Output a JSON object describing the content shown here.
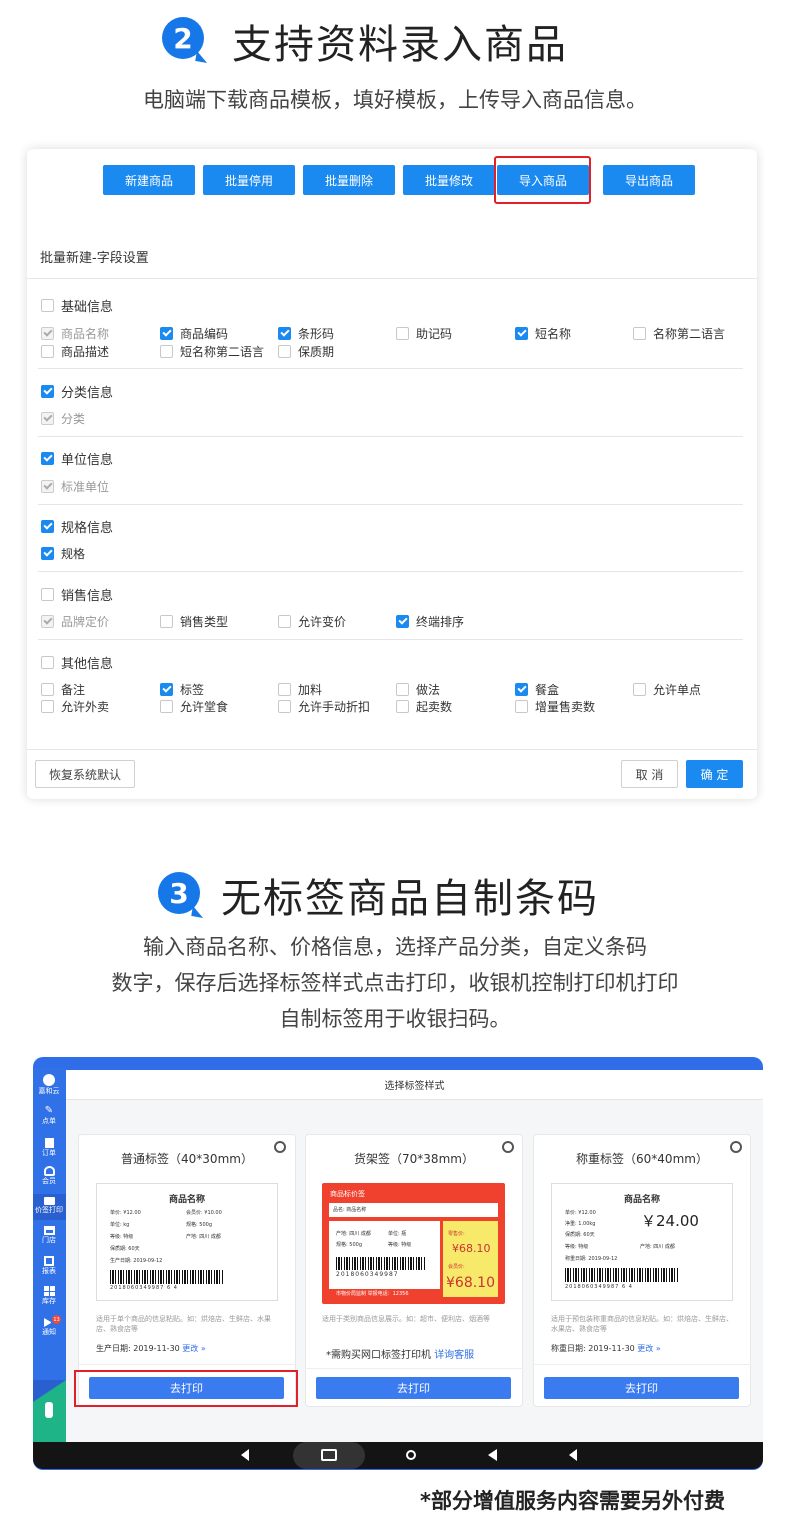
{
  "section2": {
    "number": "2",
    "title": "支持资料录入商品",
    "subtitle": "电脑端下载商品模板，填好模板，上传导入商品信息。",
    "toolbar": [
      "新建商品",
      "批量停用",
      "批量删除",
      "批量修改",
      "导入商品",
      "导出商品"
    ],
    "panel_title": "批量新建-字段设置",
    "groups": {
      "basic": {
        "label": "基础信息",
        "items": [
          "商品名称",
          "商品编码",
          "条形码",
          "助记码",
          "短名称",
          "名称第二语言",
          "商品描述",
          "短名称第二语言",
          "保质期"
        ]
      },
      "category": {
        "label": "分类信息",
        "items": [
          "分类"
        ]
      },
      "unit": {
        "label": "单位信息",
        "items": [
          "标准单位"
        ]
      },
      "spec": {
        "label": "规格信息",
        "items": [
          "规格"
        ]
      },
      "sales": {
        "label": "销售信息",
        "items": [
          "品牌定价",
          "销售类型",
          "允许变价",
          "终端排序"
        ]
      },
      "other": {
        "label": "其他信息",
        "items": [
          "备注",
          "标签",
          "加料",
          "做法",
          "餐盒",
          "允许单点",
          "允许外卖",
          "允许堂食",
          "允许手动折扣",
          "起卖数",
          "增量售卖数"
        ]
      }
    },
    "restore_label": "恢复系统默认",
    "cancel_label": "取 消",
    "confirm_label": "确 定"
  },
  "section3": {
    "number": "3",
    "title": "无标签商品自制条码",
    "subtitle_lines": [
      "输入商品名称、价格信息，选择产品分类，自定义条码",
      "数字，保存后选择标签样式点击打印，收银机控制打印机打印",
      "自制标签用于收银扫码。"
    ],
    "screen_title": "选择标签样式",
    "sidebar": [
      {
        "label": "嘉和云",
        "icon": "logo-icon"
      },
      {
        "label": "点单",
        "icon": "pen-icon"
      },
      {
        "label": "订单",
        "icon": "document-icon"
      },
      {
        "label": "会员",
        "icon": "members-icon"
      },
      {
        "label": "价签打印",
        "icon": "printer-icon"
      },
      {
        "label": "门店",
        "icon": "store-icon"
      },
      {
        "label": "报表",
        "icon": "chart-icon"
      },
      {
        "label": "库存",
        "icon": "boxes-icon"
      },
      {
        "label": "通知",
        "icon": "megaphone-icon",
        "badge": "13"
      }
    ],
    "cards": [
      {
        "title": "普通标签（40*30mm）",
        "label_name": "商品名称",
        "rows": [
          [
            "单价: ¥12.00",
            "会员价: ¥10.00"
          ],
          [
            "单位: kg",
            "规格: 500g"
          ],
          [
            "等级: 特级",
            "产地: 四川 成都"
          ],
          [
            "保质期: 60天",
            ""
          ],
          [
            "生产日期: 2019-09-12",
            ""
          ]
        ],
        "barcode": "2018060349987 6 4",
        "desc": "适用于单个商品的信息粘贴。如：烘焙店、生鲜店、水果店、熟食店等",
        "date_label": "生产日期:",
        "date": "2019-11-30",
        "change": "更改 »",
        "print": "去打印"
      },
      {
        "title": "货架签（70*38mm）",
        "tag_header": "商品标价签",
        "name_line": "品名: 商品名称",
        "info": [
          "产地: 四川 成都",
          "单位: 瓶",
          "规格: 500g",
          "等级: 特级"
        ],
        "barcode": "2018060349987",
        "footer": "市物价局监制 举报电话：12356",
        "retail_label": "零售价:",
        "retail": "¥68.10",
        "member_label": "会员价:",
        "member": "¥68.10",
        "desc": "适用于类别商品信息展示。如：超市、便利店、烟酒等",
        "note": "*需购买网口标签打印机",
        "note_link": "详询客服",
        "print": "去打印"
      },
      {
        "title": "称重标签（60*40mm）",
        "label_name": "商品名称",
        "rows": [
          "单价: ¥12.00",
          "净重: 1.00kg",
          "保质期: 60天",
          "等级: 特级",
          "称重日期: 2019-09-12"
        ],
        "origin": "产地: 四川 成都",
        "price": "￥24.00",
        "barcode": "2018060349987 6 4",
        "desc": "适用于预包装称重商品的信息粘贴。如：烘焙店、生鲜店、水果店、熟食店等",
        "date_label": "称重日期:",
        "date": "2019-11-30",
        "change": "更改 »",
        "print": "去打印"
      }
    ],
    "footnote": "*部分增值服务内容需要另外付费"
  },
  "colors": {
    "accent": "#1a89f0",
    "highlight": "#e0202a",
    "tag_red": "#f0412f",
    "tag_yellow": "#f7e96a"
  }
}
